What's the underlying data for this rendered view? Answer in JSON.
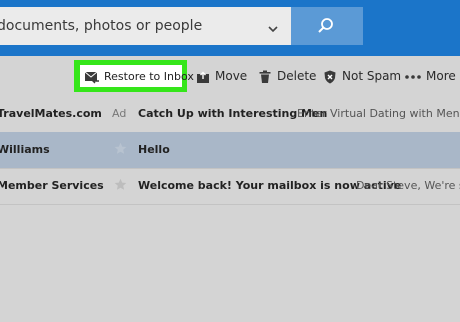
{
  "search": {
    "placeholder": "documents, photos or people"
  },
  "toolbar": {
    "restore_label": "Restore to Inbox",
    "move_label": "Move",
    "delete_label": "Delete",
    "not_spam_label": "Not Spam",
    "more_label": "More"
  },
  "messages": [
    {
      "sender": "TravelMates.com",
      "badge": "Ad",
      "subject": "Catch Up with Interesting Men",
      "preview": "Enter Virtual Dating with Men & Ke"
    },
    {
      "sender": "Williams",
      "subject": "Hello",
      "preview": ""
    },
    {
      "sender": "Member Services",
      "subject": "Welcome back! Your mailbox is now active",
      "preview": "Dear Steve, We're so gl"
    }
  ],
  "colors": {
    "header": "#1b75c9",
    "search_button": "#5b9ad6",
    "highlight": "#35e61a",
    "selected_row": "#a9b7c8",
    "background": "#d4d4d4"
  },
  "icons": {
    "search": "magnifier-icon",
    "chevron": "chevron-down-icon",
    "restore": "restore-envelope-icon",
    "move": "move-folder-icon",
    "delete": "trash-icon",
    "not_spam": "shield-x-icon",
    "more": "more-dots-icon",
    "star": "star-icon"
  }
}
